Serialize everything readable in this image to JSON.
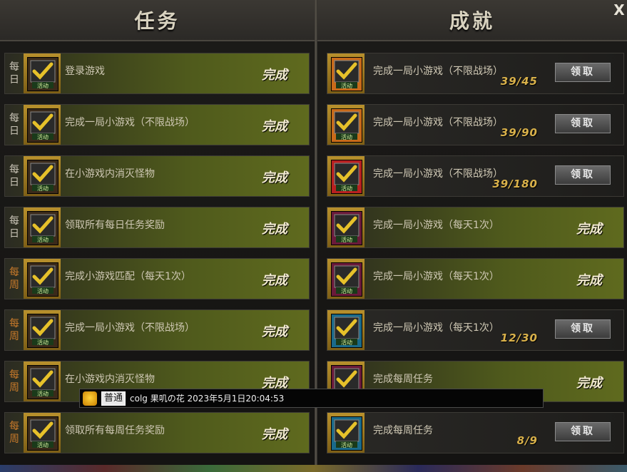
{
  "tasks_panel": {
    "title": "任务",
    "rows": [
      {
        "period": [
          "每",
          "日"
        ],
        "weekly": false,
        "name": "登录游戏",
        "status": "完成"
      },
      {
        "period": [
          "每",
          "日"
        ],
        "weekly": false,
        "name": "完成一局小游戏（不限战场）",
        "status": "完成"
      },
      {
        "period": [
          "每",
          "日"
        ],
        "weekly": false,
        "name": "在小游戏内消灭怪物",
        "status": "完成"
      },
      {
        "period": [
          "每",
          "日"
        ],
        "weekly": false,
        "name": "领取所有每日任务奖励",
        "status": "完成"
      },
      {
        "period": [
          "每",
          "周"
        ],
        "weekly": true,
        "name": "完成小游戏匹配（每天1次）",
        "status": "完成"
      },
      {
        "period": [
          "每",
          "周"
        ],
        "weekly": true,
        "name": "完成一局小游戏（不限战场）",
        "status": "完成"
      },
      {
        "period": [
          "每",
          "周"
        ],
        "weekly": true,
        "name": "在小游戏内消灭怪物",
        "status": "完成"
      },
      {
        "period": [
          "每",
          "周"
        ],
        "weekly": true,
        "name": "领取所有每周任务奖励",
        "status": "完成"
      }
    ]
  },
  "achievements_panel": {
    "title": "成就",
    "rows": [
      {
        "name": "完成一局小游戏（不限战场）",
        "progress": "39/45",
        "button": "领取"
      },
      {
        "name": "完成一局小游戏（不限战场）",
        "progress": "39/90",
        "button": "领取"
      },
      {
        "name": "完成一局小游戏（不限战场）",
        "progress": "39/180",
        "button": "领取"
      },
      {
        "name": "完成一局小游戏（每天1次）",
        "status": "完成"
      },
      {
        "name": "完成一局小游戏（每天1次）",
        "status": "完成"
      },
      {
        "name": "完成一局小游戏（每天1次）",
        "progress": "12/30",
        "button": "领取"
      },
      {
        "name": "完成每周任务",
        "status": "完成"
      },
      {
        "name": "完成每周任务",
        "progress": "8/9",
        "button": "领取"
      }
    ]
  },
  "close_label": "X",
  "chat": {
    "channel": "普通",
    "message": "colg 果叽の花 2023年5月1日20:04:53"
  }
}
